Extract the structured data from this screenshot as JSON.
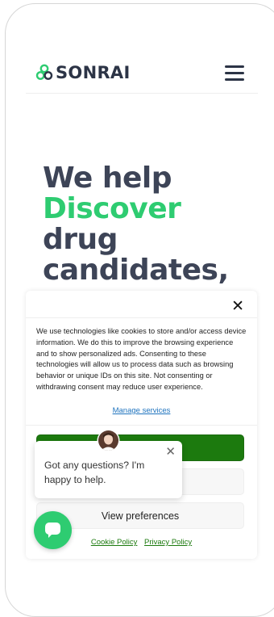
{
  "header": {
    "logo_text": "SONRAI",
    "menu_icon": "hamburger-menu-icon"
  },
  "hero": {
    "line1": "We help",
    "line2": "Discover",
    "line3": "drug",
    "line4": "candidates,"
  },
  "cookie_banner": {
    "close_label": "✕",
    "message": "We use technologies like cookies to store and/or access device information. We do this to improve the browsing experience and to show personalized ads. Consenting to these technologies will allow us to process data such as browsing behavior or unique IDs on this site. Not consenting or withdrawing consent may reduce user experience.",
    "manage_services": "Manage services",
    "view_preferences": "View preferences",
    "cookie_policy": "Cookie Policy",
    "privacy_policy": "Privacy Policy"
  },
  "chat": {
    "message": "Got any questions? I'm happy to help.",
    "close_label": "✕"
  },
  "colors": {
    "brand_dark": "#2c3446",
    "brand_green": "#2ecc71",
    "accept_green": "#1c7a0e",
    "link_blue": "#1e73be"
  }
}
